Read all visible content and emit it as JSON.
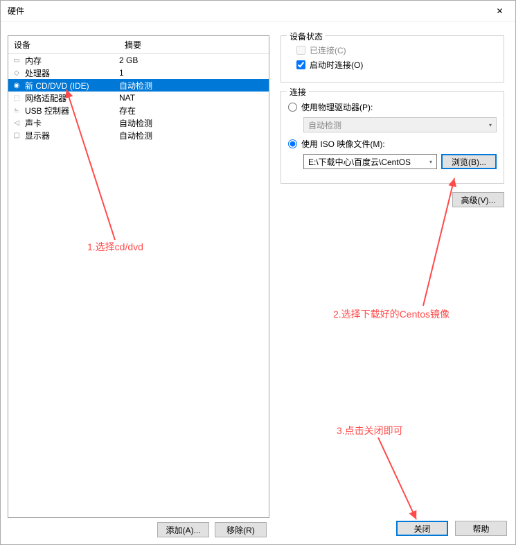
{
  "window": {
    "title": "硬件",
    "close": "✕"
  },
  "deviceList": {
    "header": {
      "device": "设备",
      "summary": "摘要"
    },
    "rows": [
      {
        "icon": "memory",
        "name": "内存",
        "summary": "2 GB",
        "selected": false
      },
      {
        "icon": "cpu",
        "name": "处理器",
        "summary": "1",
        "selected": false
      },
      {
        "icon": "disc",
        "name": "新 CD/DVD (IDE)",
        "summary": "自动检测",
        "selected": true
      },
      {
        "icon": "network",
        "name": "网络适配器",
        "summary": "NAT",
        "selected": false
      },
      {
        "icon": "usb",
        "name": "USB 控制器",
        "summary": "存在",
        "selected": false
      },
      {
        "icon": "sound",
        "name": "声卡",
        "summary": "自动检测",
        "selected": false
      },
      {
        "icon": "display",
        "name": "显示器",
        "summary": "自动检测",
        "selected": false
      }
    ]
  },
  "leftButtons": {
    "add": "添加(A)...",
    "remove": "移除(R)"
  },
  "deviceStatus": {
    "legend": "设备状态",
    "connected": "已连接(C)",
    "connectAtPowerOn": "启动时连接(O)"
  },
  "connection": {
    "legend": "连接",
    "physical": "使用物理驱动器(P):",
    "physicalValue": "自动检测",
    "iso": "使用 ISO 映像文件(M):",
    "isoValue": "E:\\下载中心\\百度云\\CentOS",
    "browse": "浏览(B)..."
  },
  "advanced": "高级(V)...",
  "dialogButtons": {
    "close": "关闭",
    "help": "帮助"
  },
  "annotations": {
    "a1": "1.选择cd/dvd",
    "a2": "2.选择下载好的Centos镜像",
    "a3": "3.点击关闭即可"
  },
  "icons": {
    "memory": "▭",
    "cpu": "◇",
    "disc": "◉",
    "network": "⬚",
    "usb": "⎁",
    "sound": "◁",
    "display": "▢"
  }
}
